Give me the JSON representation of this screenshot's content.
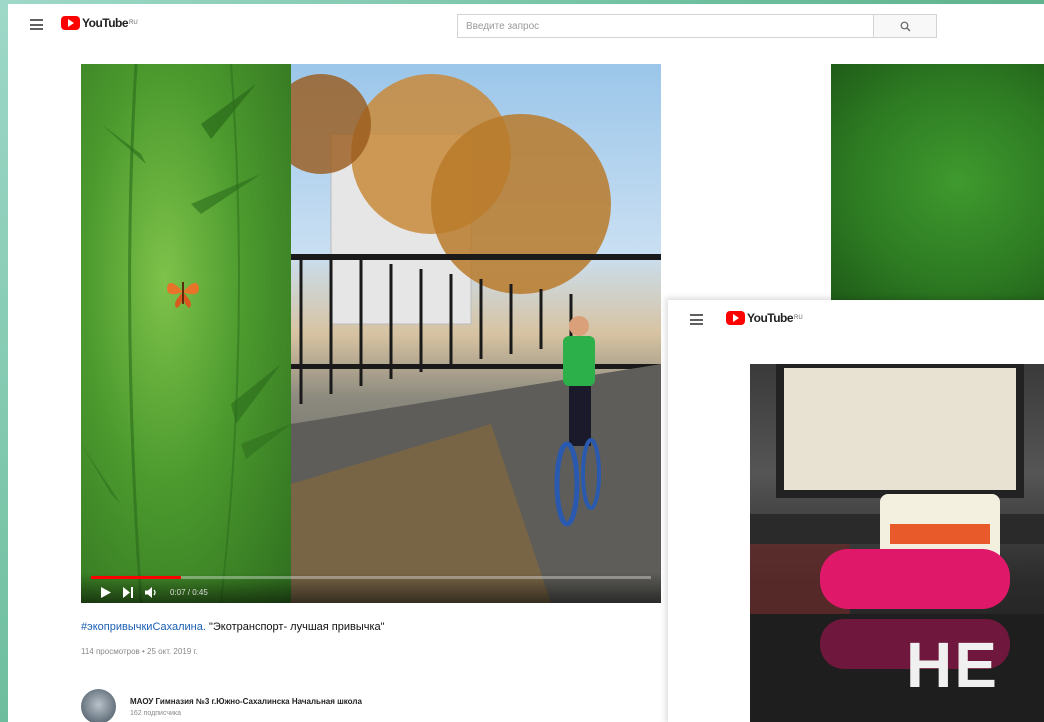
{
  "header": {
    "logo_text": "YouTube",
    "logo_sup": "RU",
    "search_placeholder": "Введите запрос"
  },
  "player": {
    "time": "0:07 / 0:45",
    "progress": 0.16
  },
  "video": {
    "hashtag": "#экопривычкиСахалина.",
    "title": " \"Экотранспорт- лучшая привычка\"",
    "meta": "114 просмотров • 25 окт. 2019 г."
  },
  "channel": {
    "name": "МАОУ Гимназия №3 г.Южно-Сахалинска Начальная школа",
    "subs": "162 подписчика"
  },
  "overlay": {
    "logo_text": "YouTube",
    "logo_sup": "RU",
    "big_text": "НЕ"
  },
  "icons": {
    "menu": "hamburger-icon",
    "search": "search-icon",
    "play": "play-icon",
    "next": "next-icon",
    "volume": "volume-icon",
    "butterfly": "butterfly-icon"
  },
  "colors": {
    "youtube_red": "#ff0000",
    "link_blue": "#1a5fb4"
  }
}
